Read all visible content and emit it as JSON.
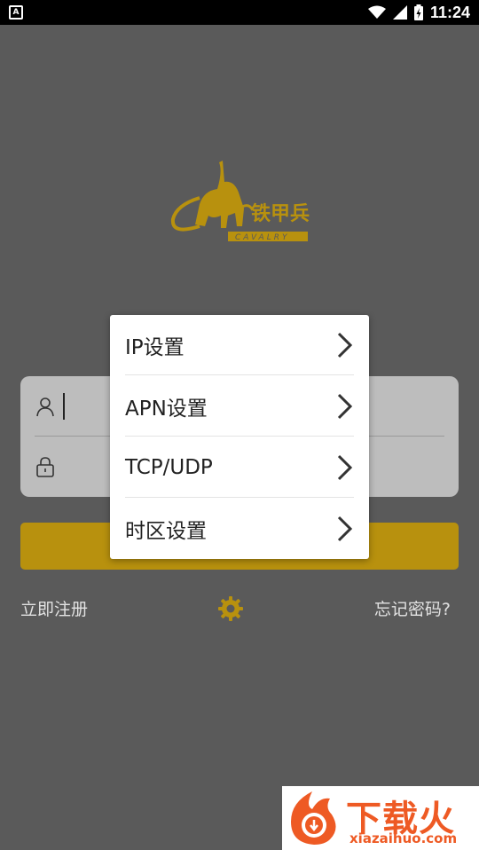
{
  "status_bar": {
    "time": "11:24",
    "left_icon": "a-box-icon",
    "right_icons": [
      "wifi-icon",
      "cellular-signal-icon",
      "battery-charging-icon"
    ]
  },
  "logo": {
    "brand_chinese": "铁甲兵",
    "brand_english": "CAVALRY",
    "color": "#b8910e"
  },
  "login_form": {
    "username_icon": "user-icon",
    "password_icon": "lock-icon"
  },
  "links": {
    "register": "立即注册",
    "forgot_password": "忘记密码?",
    "settings_icon": "gear-icon"
  },
  "settings_menu": {
    "items": [
      {
        "label": "IP设置",
        "icon": "chevron-right-icon"
      },
      {
        "label": "APN设置",
        "icon": "chevron-right-icon"
      },
      {
        "label": "TCP/UDP",
        "icon": "chevron-right-icon"
      },
      {
        "label": "时区设置",
        "icon": "chevron-right-icon"
      }
    ]
  },
  "watermark": {
    "title": "下载火",
    "url": "xiazaihuo.com"
  },
  "colors": {
    "background": "#5a5a5a",
    "accent": "#b8910e",
    "watermark_accent": "#ee5a24"
  }
}
